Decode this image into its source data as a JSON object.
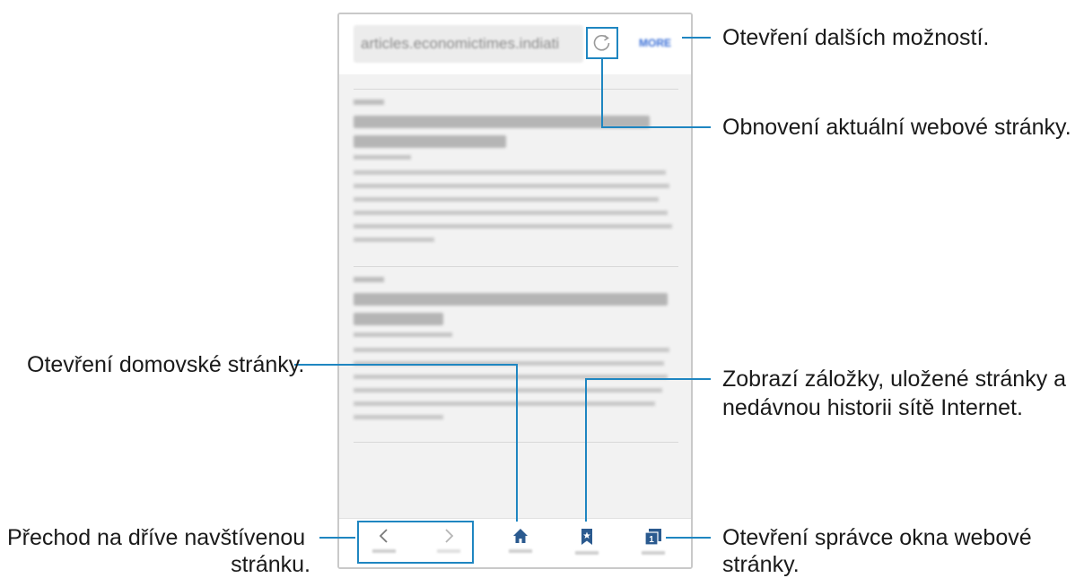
{
  "browser": {
    "url": "articles.economictimes.indiati",
    "more_label": "MORE"
  },
  "callouts": {
    "more_options": "Otevření dalších možností.",
    "refresh": "Obnovení aktuální webové stránky.",
    "bookmarks_line1": "Zobrazí záložky, uložené stránky a",
    "bookmarks_line2": "nedávnou historii sítě Internet.",
    "home": "Otevření domovské stránky.",
    "back_line1": "Přechod na dříve navštívenou",
    "back_line2": "stránku.",
    "tabs_line1": "Otevření správce okna webové",
    "tabs_line2": "stránky."
  },
  "icons": {
    "refresh": "refresh-icon",
    "back": "chevron-left-icon",
    "forward": "chevron-right-icon",
    "home": "home-icon",
    "bookmarks": "bookmark-icon",
    "tabs": "tabs-icon"
  },
  "colors": {
    "accent": "#1f86c1"
  }
}
